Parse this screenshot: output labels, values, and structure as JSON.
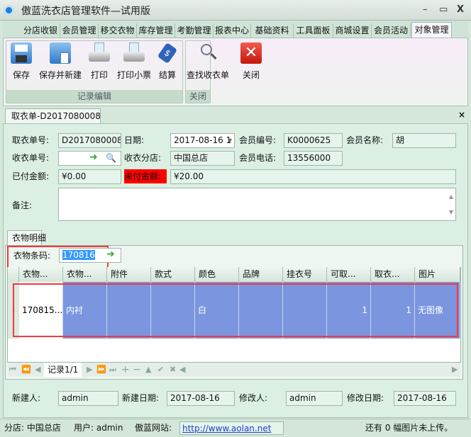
{
  "window": {
    "title": "傲蓝洗衣店管理软件—试用版",
    "minimize": "–",
    "maximize": "▭",
    "close": "X"
  },
  "menu_tabs": [
    "分店收银",
    "会员管理",
    "移交衣物",
    "库存管理",
    "考勤管理",
    "报表中心",
    "基础资料",
    "工具面板",
    "商城设置",
    "会员活动",
    "对象管理"
  ],
  "ribbon": {
    "group1_label": "记录编辑",
    "group2_label": "关闭",
    "buttons": [
      "保存",
      "保存并新建",
      "打印",
      "打印小票",
      "结算",
      "查找收衣单"
    ],
    "close": "关闭"
  },
  "doc_tab": {
    "label": "取衣单-D2017080008",
    "close": "×"
  },
  "form": {
    "order_no_label": "取衣单号:",
    "order_no": "D2017080008",
    "date_label": "日期:",
    "date": "2017-08-16 1",
    "member_no_label": "会员编号:",
    "member_no": "K0000625",
    "member_name_label": "会员名称:",
    "member_name": "胡",
    "receive_no_label": "收衣单号:",
    "receive_no": "",
    "branch_label": "收衣分店:",
    "branch": "中国总店",
    "phone_label": "会员电话:",
    "phone": "13556000",
    "paid_label": "已付金额:",
    "paid": "¥0.00",
    "unpaid_label": "未付金额:",
    "unpaid": "¥20.00",
    "remark_label": "备注:",
    "remark": ""
  },
  "detail": {
    "tab": "衣物明细",
    "barcode_label": "衣物条码:",
    "barcode": "170816",
    "columns": [
      "衣物...",
      "衣物...",
      "附件",
      "款式",
      "颜色",
      "品牌",
      "挂衣号",
      "可取...",
      "取衣...",
      "图片"
    ],
    "rows": [
      [
        "170815...",
        "内衬",
        "",
        "",
        "白",
        "",
        "",
        "1",
        "1",
        "无图像"
      ]
    ],
    "nav_record": "记录1/1"
  },
  "footer": {
    "creator_label": "新建人:",
    "creator": "admin",
    "created_label": "新建日期:",
    "created": "2017-08-16",
    "modifier_label": "修改人:",
    "modifier": "admin",
    "modified_label": "修改日期:",
    "modified": "2017-08-16"
  },
  "status": {
    "branch": "分店: 中国总店",
    "user": "用户: admin",
    "site_label": "傲蓝网站:",
    "site_url": "http://www.aolan.net",
    "upload": "还有 0 幅图片未上传。"
  },
  "colors": {
    "accent_red": "#ff0000",
    "selection": "#7b96de",
    "panel": "#dcefe3"
  }
}
